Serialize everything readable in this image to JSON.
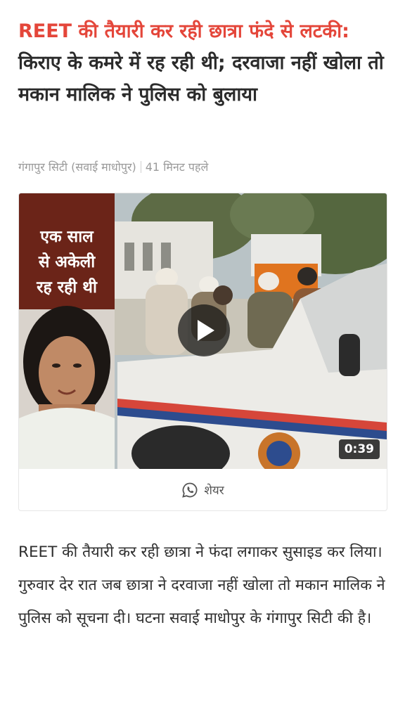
{
  "article": {
    "headline_highlight": "REET की तैयारी कर रही छात्रा फंदे से लटकी:",
    "headline_rest": " किराए के कमरे में रह रही थी; दरवाजा नहीं खोला तो मकान मालिक ने पुलिस को बुलाया",
    "location": "गंगापुर सिटी (सवाई माधोपुर)",
    "time_ago": "41 मिनट पहले",
    "body": "REET की तैयारी कर रही छात्रा ने फंदा लगाकर सुसाइड कर लिया। गुरुवार देर रात जब छात्रा ने दरवाजा नहीं खोला तो मकान मालिक ने पुलिस को सूचना दी। घटना सवाई माधोपुर के गंगापुर सिटी की है।"
  },
  "video": {
    "promo_line1": "एक साल",
    "promo_line2": "से अकेली",
    "promo_line3": "रह रही थी",
    "duration": "0:39",
    "play_icon": "play-icon"
  },
  "share": {
    "label": "शेयर",
    "icon": "whatsapp-icon"
  },
  "colors": {
    "headline_accent": "#e4463a",
    "promo_panel": "#6b2418",
    "meta_text": "#9a9a9a"
  }
}
